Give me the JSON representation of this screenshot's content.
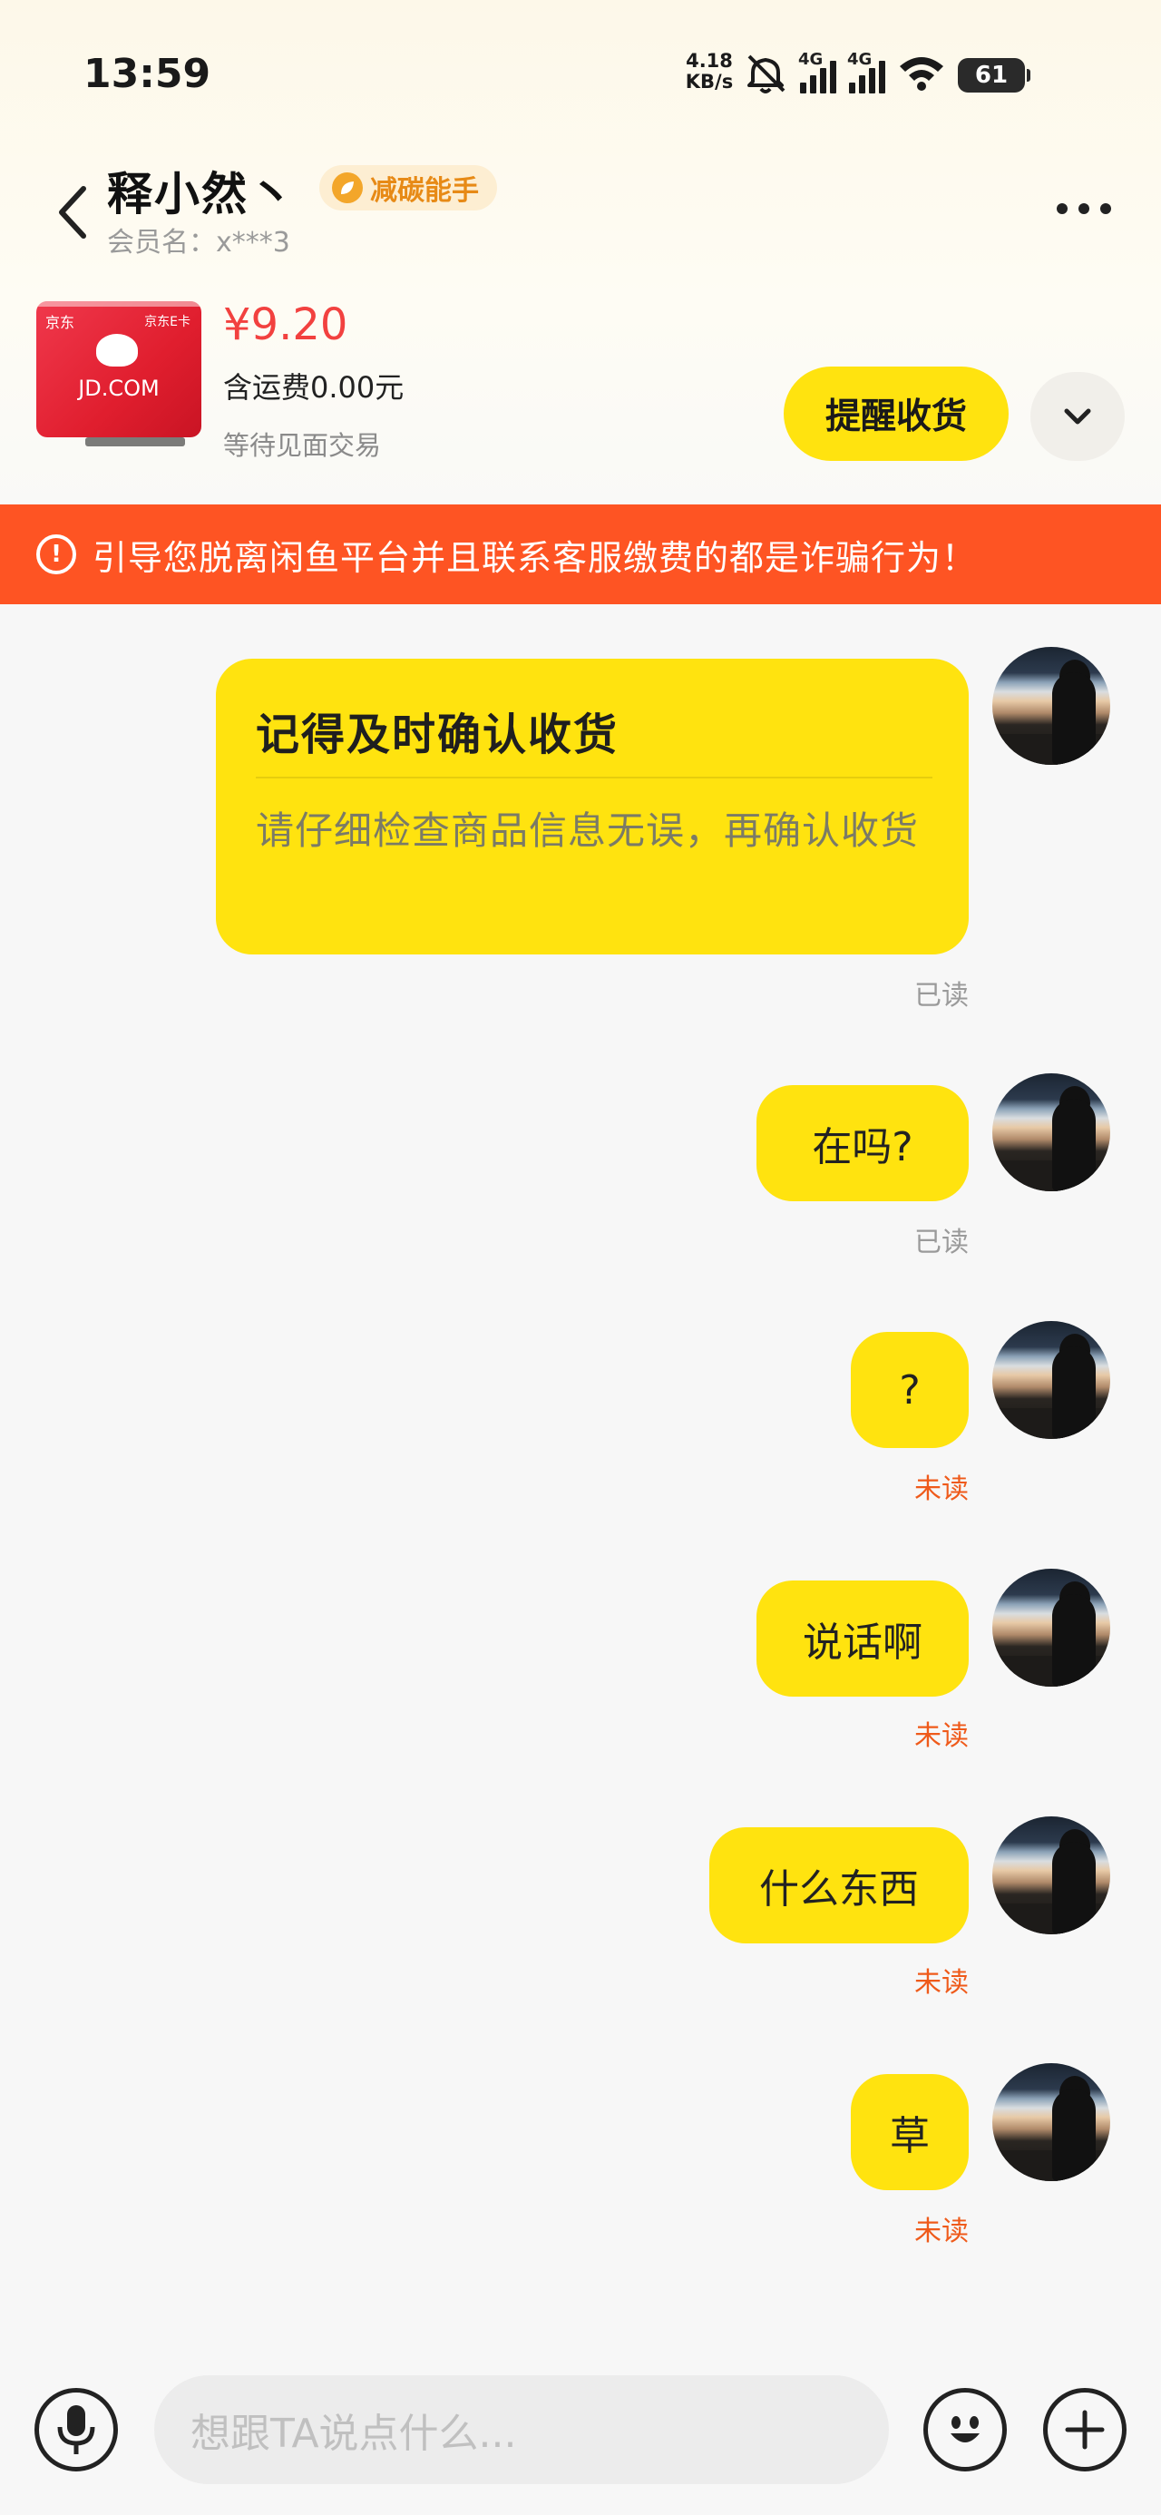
{
  "status_bar": {
    "time": "13:59",
    "net_speed_value": "4.18",
    "net_speed_unit": "KB/s",
    "sim1_label": "4G",
    "sim2_label": "4G",
    "battery": "61"
  },
  "header": {
    "seller_name": "释小然丶",
    "badge_label": "减碳能手",
    "member_label": "会员名：x***3"
  },
  "product": {
    "image_brand": "京东",
    "image_card": "京东E卡",
    "image_text": "JD.COM",
    "price": "¥9.20",
    "shipping": "含运费0.00元",
    "status": "等待见面交易",
    "remind_button": "提醒收货"
  },
  "warning": {
    "text": "引导您脱离闲鱼平台并且联系客服缴费的都是诈骗行为！"
  },
  "messages": [
    {
      "type": "card",
      "title": "记得及时确认收货",
      "desc": "请仔细检查商品信息无误，再确认收货",
      "status": "已读",
      "status_kind": "read"
    },
    {
      "type": "text",
      "text": "在吗?",
      "status": "已读",
      "status_kind": "read"
    },
    {
      "type": "text",
      "text": "?",
      "status": "未读",
      "status_kind": "unread"
    },
    {
      "type": "text",
      "text": "说话啊",
      "status": "未读",
      "status_kind": "unread"
    },
    {
      "type": "text",
      "text": "什么东西",
      "status": "未读",
      "status_kind": "unread"
    },
    {
      "type": "text",
      "text": "草",
      "status": "未读",
      "status_kind": "unread"
    }
  ],
  "input": {
    "placeholder": "想跟TA说点什么..."
  },
  "colors": {
    "bubble": "#ffe30f",
    "warning_bar": "#fe5423",
    "price": "#f2413f",
    "unread": "#ef5a1a",
    "read": "#9a9a9a"
  },
  "icons": {
    "back": "back-arrow-icon",
    "more": "more-icon",
    "expand": "chevron-down-icon",
    "warning": "exclamation-icon",
    "voice": "microphone-icon",
    "emoji": "emoji-icon",
    "add": "plus-icon"
  }
}
